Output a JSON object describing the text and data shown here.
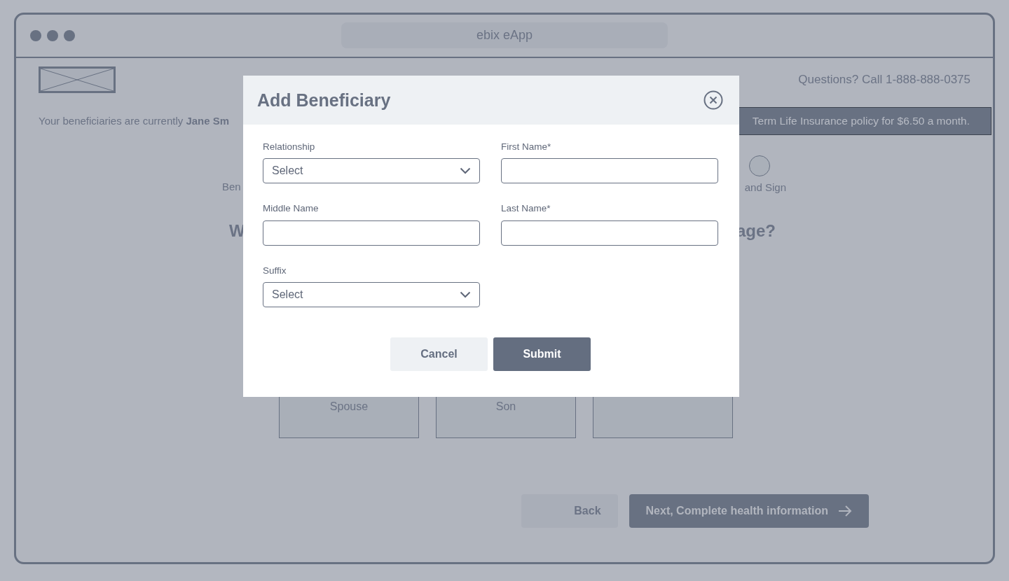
{
  "window": {
    "title": "ebix eApp"
  },
  "header": {
    "phone": "Questions? Call 1-888-888-0375"
  },
  "summary": "Your beneficiaries are currently **Jane Sm**",
  "banner": "Term Life Insurance policy for $6.50 a month.",
  "steps": {
    "left_label": "Ben",
    "right_label": "and Sign"
  },
  "question": {
    "start": "W",
    "end": "age?"
  },
  "cards": [
    {
      "kind": "person",
      "relationship": "Spouse"
    },
    {
      "kind": "person",
      "relationship": "Son"
    },
    {
      "kind": "add"
    }
  ],
  "footer_buttons": [
    {
      "kind": "secondary",
      "label": "Back"
    },
    {
      "kind": "primary",
      "label": "Next, Complete health information"
    }
  ],
  "modal": {
    "title": "Add Beneficiary",
    "fields": [
      {
        "kind": "select",
        "label": "Relationship",
        "value": "Select"
      },
      {
        "kind": "text",
        "label": "First Name*"
      },
      {
        "kind": "text",
        "label": "Middle Name"
      },
      {
        "kind": "text",
        "label": "Last Name*"
      },
      {
        "kind": "select",
        "label": "Suffix",
        "value": "Select"
      }
    ],
    "buttons": [
      {
        "kind": "secondary",
        "label": "Cancel"
      },
      {
        "kind": "primary",
        "label": "Submit"
      }
    ]
  }
}
